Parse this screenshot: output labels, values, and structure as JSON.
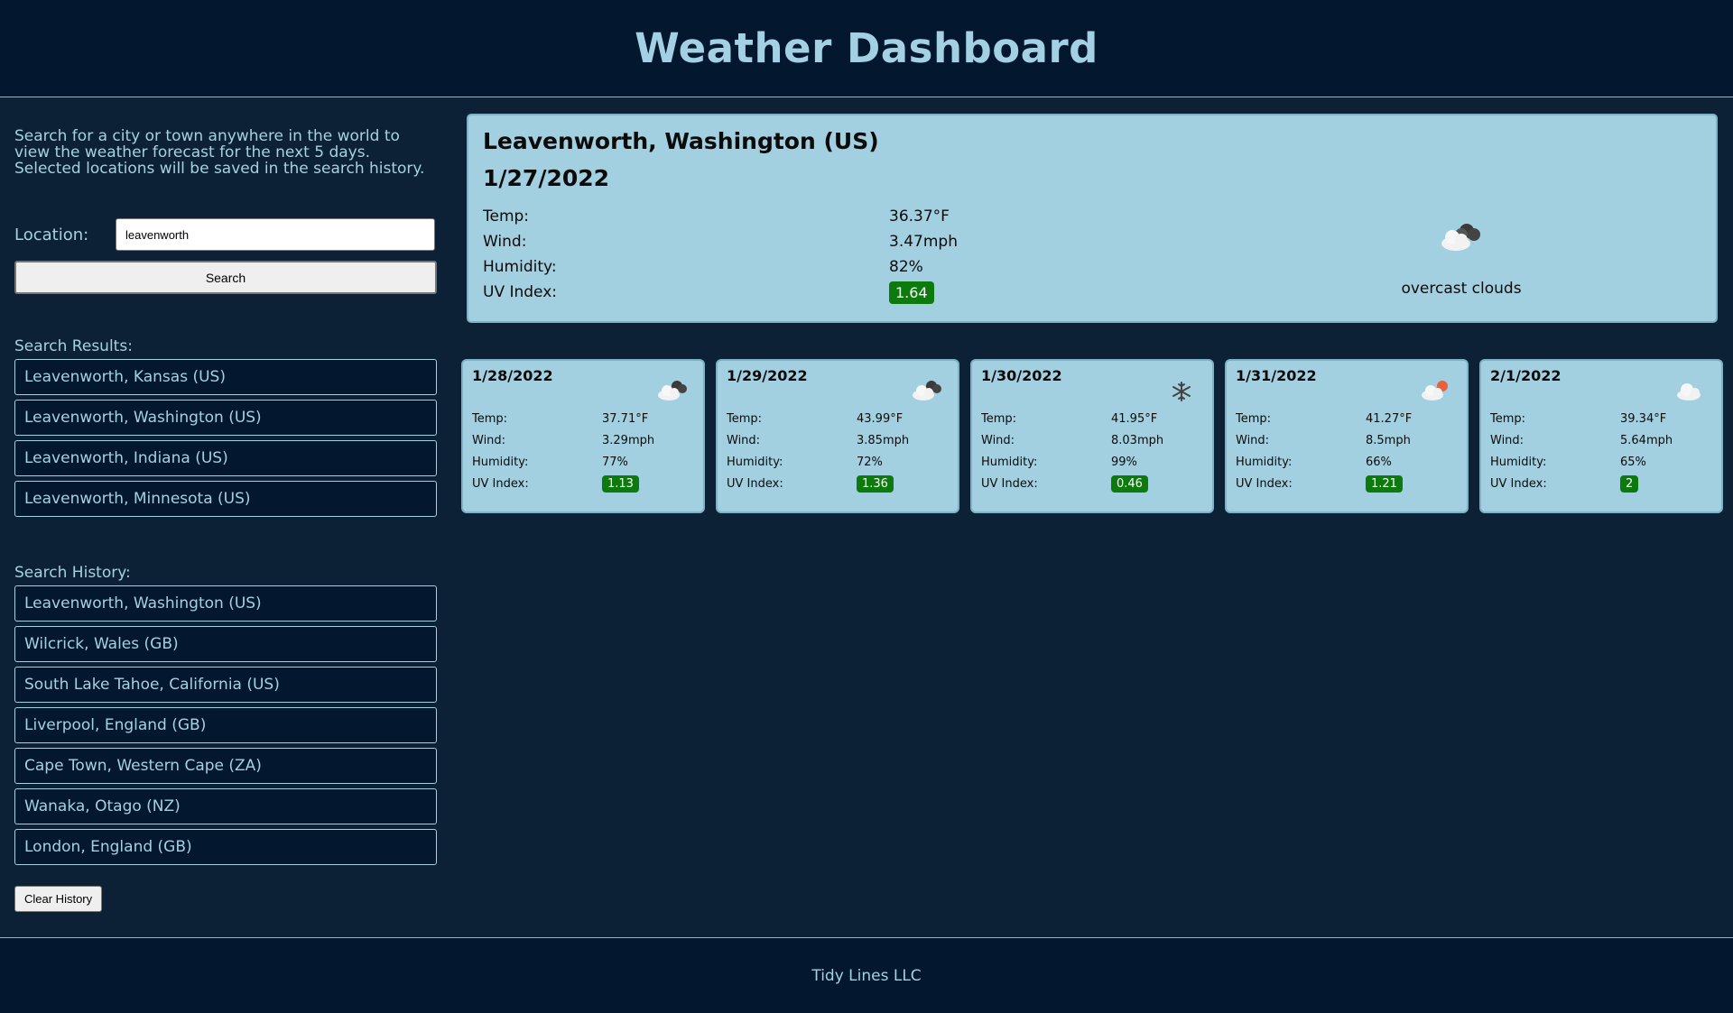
{
  "header": {
    "title": "Weather Dashboard"
  },
  "sidebar": {
    "intro": "Search for a city or town anywhere in the world to view the weather forecast for the next 5 days. Selected locations will be saved in the search history.",
    "location_label": "Location:",
    "location_value": "leavenworth",
    "search_label": "Search",
    "results_title": "Search Results:",
    "results": [
      "Leavenworth, Kansas (US)",
      "Leavenworth, Washington (US)",
      "Leavenworth, Indiana (US)",
      "Leavenworth, Minnesota (US)"
    ],
    "history_title": "Search History:",
    "history": [
      "Leavenworth, Washington (US)",
      "Wilcrick, Wales (GB)",
      "South Lake Tahoe, California (US)",
      "Liverpool, England (GB)",
      "Cape Town, Western Cape (ZA)",
      "Wanaka, Otago (NZ)",
      "London, England (GB)"
    ],
    "clear_label": "Clear History"
  },
  "current": {
    "city": "Leavenworth, Washington (US)",
    "date": "1/27/2022",
    "labels": {
      "temp": "Temp:",
      "wind": "Wind:",
      "humidity": "Humidity:",
      "uv": "UV Index:"
    },
    "temp": "36.37°F",
    "wind": "3.47mph",
    "humidity": "82%",
    "uv": "1.64",
    "icon": "cloud-icon",
    "condition": "overcast clouds"
  },
  "forecast": [
    {
      "date": "1/28/2022",
      "icon": "cloud-icon",
      "temp": "37.71°F",
      "wind": "3.29mph",
      "humidity": "77%",
      "uv": "1.13"
    },
    {
      "date": "1/29/2022",
      "icon": "cloud-icon",
      "temp": "43.99°F",
      "wind": "3.85mph",
      "humidity": "72%",
      "uv": "1.36"
    },
    {
      "date": "1/30/2022",
      "icon": "snowflake-icon",
      "temp": "41.95°F",
      "wind": "8.03mph",
      "humidity": "99%",
      "uv": "0.46"
    },
    {
      "date": "1/31/2022",
      "icon": "partly-sunny-icon",
      "temp": "41.27°F",
      "wind": "8.5mph",
      "humidity": "66%",
      "uv": "1.21"
    },
    {
      "date": "2/1/2022",
      "icon": "light-cloud-icon",
      "temp": "39.34°F",
      "wind": "5.64mph",
      "humidity": "65%",
      "uv": "2"
    }
  ],
  "colors": {
    "uv_good": "#0c7a0c",
    "card_bg": "#a3d0e0",
    "page_bg": "#0c2136"
  },
  "footer": {
    "text": "Tidy Lines LLC"
  }
}
